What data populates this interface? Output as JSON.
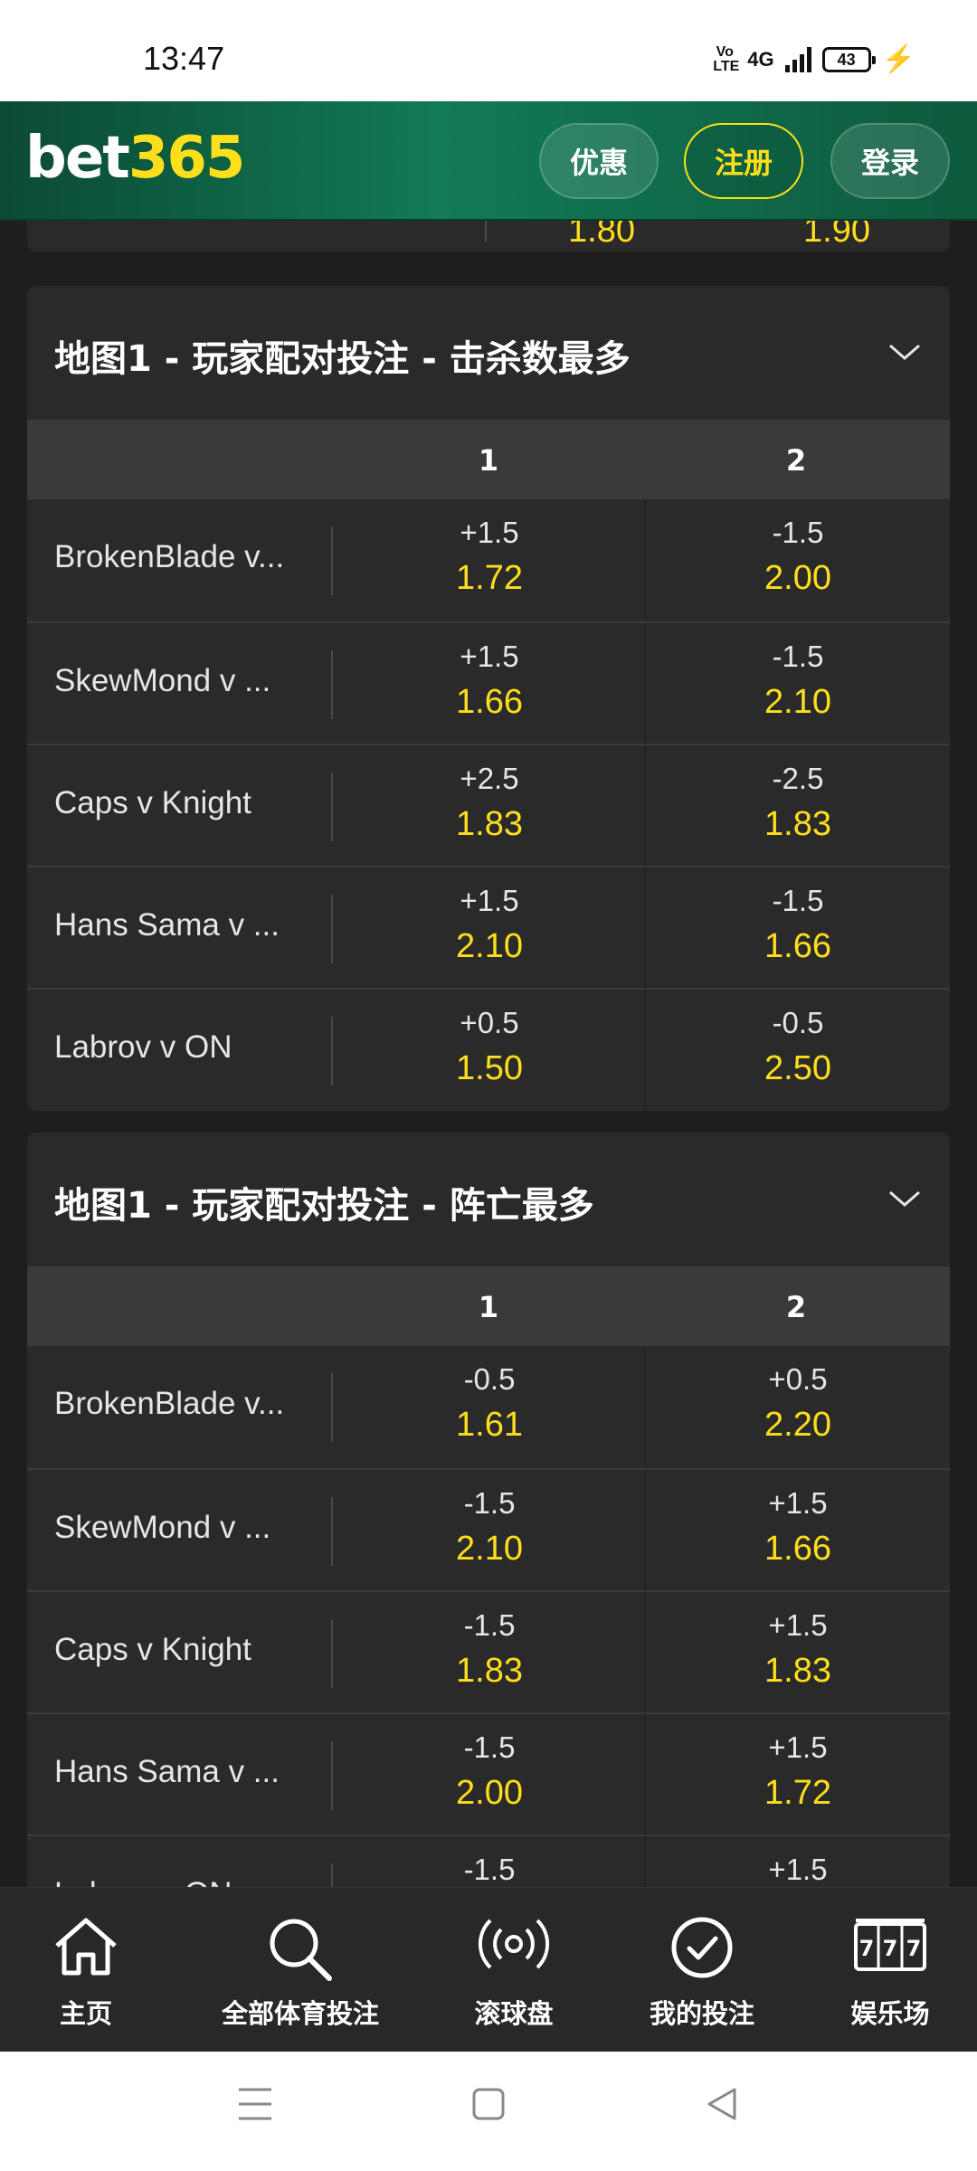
{
  "status_bar": {
    "time": "13:47",
    "volte": "Vo LTE",
    "network": "4G",
    "battery": "43"
  },
  "header": {
    "logo_bet": "bet",
    "logo_num": "365",
    "offers": "优惠",
    "join": "注册",
    "login": "登录"
  },
  "top_partial": {
    "odds": [
      "1.80",
      "1.90"
    ]
  },
  "markets": [
    {
      "title": "地图1 - 玩家配对投注 - 击杀数最多",
      "col1": "1",
      "col2": "2",
      "rows": [
        {
          "name": "BrokenBlade v...",
          "line1": "+1.5",
          "odds1": "1.72",
          "line2": "-1.5",
          "odds2": "2.00"
        },
        {
          "name": "SkewMond v ...",
          "line1": "+1.5",
          "odds1": "1.66",
          "line2": "-1.5",
          "odds2": "2.10"
        },
        {
          "name": "Caps v Knight",
          "line1": "+2.5",
          "odds1": "1.83",
          "line2": "-2.5",
          "odds2": "1.83"
        },
        {
          "name": "Hans Sama v ...",
          "line1": "+1.5",
          "odds1": "2.10",
          "line2": "-1.5",
          "odds2": "1.66"
        },
        {
          "name": "Labrov v ON",
          "line1": "+0.5",
          "odds1": "1.50",
          "line2": "-0.5",
          "odds2": "2.50"
        }
      ]
    },
    {
      "title": "地图1 - 玩家配对投注 - 阵亡最多",
      "col1": "1",
      "col2": "2",
      "rows": [
        {
          "name": "BrokenBlade v...",
          "line1": "-0.5",
          "odds1": "1.61",
          "line2": "+0.5",
          "odds2": "2.20"
        },
        {
          "name": "SkewMond v ...",
          "line1": "-1.5",
          "odds1": "2.10",
          "line2": "+1.5",
          "odds2": "1.66"
        },
        {
          "name": "Caps v Knight",
          "line1": "-1.5",
          "odds1": "1.83",
          "line2": "+1.5",
          "odds2": "1.83"
        },
        {
          "name": "Hans Sama v ...",
          "line1": "-1.5",
          "odds1": "2.00",
          "line2": "+1.5",
          "odds2": "1.72"
        },
        {
          "name": "Labrov v ON",
          "line1": "-1.5",
          "odds1": "",
          "line2": "+1.5",
          "odds2": ""
        }
      ]
    }
  ],
  "tabbar": [
    {
      "label": "主页",
      "icon": "home-icon"
    },
    {
      "label": "全部体育投注",
      "icon": "search-icon"
    },
    {
      "label": "滚球盘",
      "icon": "live-broadcast-icon"
    },
    {
      "label": "我的投注",
      "icon": "check-circle-icon"
    },
    {
      "label": "娱乐场",
      "icon": "slot-machine-icon"
    }
  ],
  "colors": {
    "accent_yellow": "#ffdf1b",
    "header_green": "#127a55",
    "panel": "#2a2a2a",
    "column_header": "#3a3a3a"
  }
}
